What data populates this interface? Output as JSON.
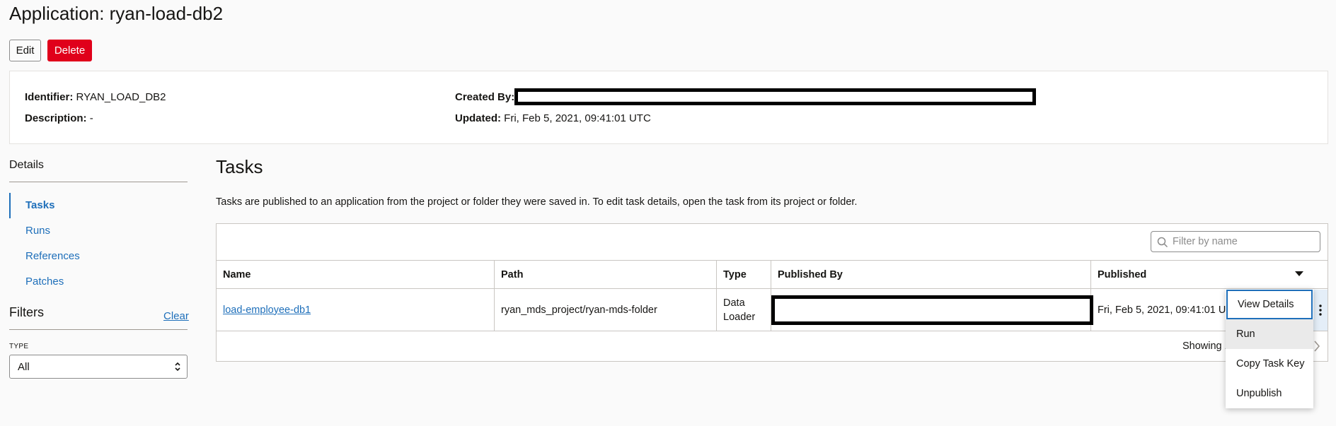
{
  "page": {
    "title": "Application: ryan-load-db2"
  },
  "actions": {
    "edit_label": "Edit",
    "delete_label": "Delete"
  },
  "info": {
    "identifier_label": "Identifier:",
    "identifier_value": "RYAN_LOAD_DB2",
    "description_label": "Description:",
    "description_value": "-",
    "created_by_label": "Created By:",
    "updated_label": "Updated:",
    "updated_value": "Fri, Feb 5, 2021, 09:41:01 UTC"
  },
  "sidebar": {
    "heading": "Details",
    "items": [
      {
        "label": "Tasks",
        "active": true
      },
      {
        "label": "Runs",
        "active": false
      },
      {
        "label": "References",
        "active": false
      },
      {
        "label": "Patches",
        "active": false
      }
    ],
    "filters_heading": "Filters",
    "clear_label": "Clear",
    "type_label": "TYPE",
    "type_value": "All"
  },
  "tasks": {
    "title": "Tasks",
    "description": "Tasks are published to an application from the project or folder they were saved in. To edit task details, open the task from its project or folder.",
    "filter_placeholder": "Filter by name",
    "columns": [
      "Name",
      "Path",
      "Type",
      "Published By",
      "Published"
    ],
    "rows": [
      {
        "name": "load-employee-db1",
        "path": "ryan_mds_project/ryan-mds-folder",
        "type_line1": "Data",
        "type_line2": "Loader",
        "published": "Fri, Feb 5, 2021, 09:41:01 U"
      }
    ],
    "showing_text": "Showing 1"
  },
  "context_menu": {
    "items": [
      "View Details",
      "Run",
      "Copy Task Key",
      "Unpublish"
    ]
  },
  "colors": {
    "accent": "#1e6fba",
    "danger": "#e0001b"
  }
}
